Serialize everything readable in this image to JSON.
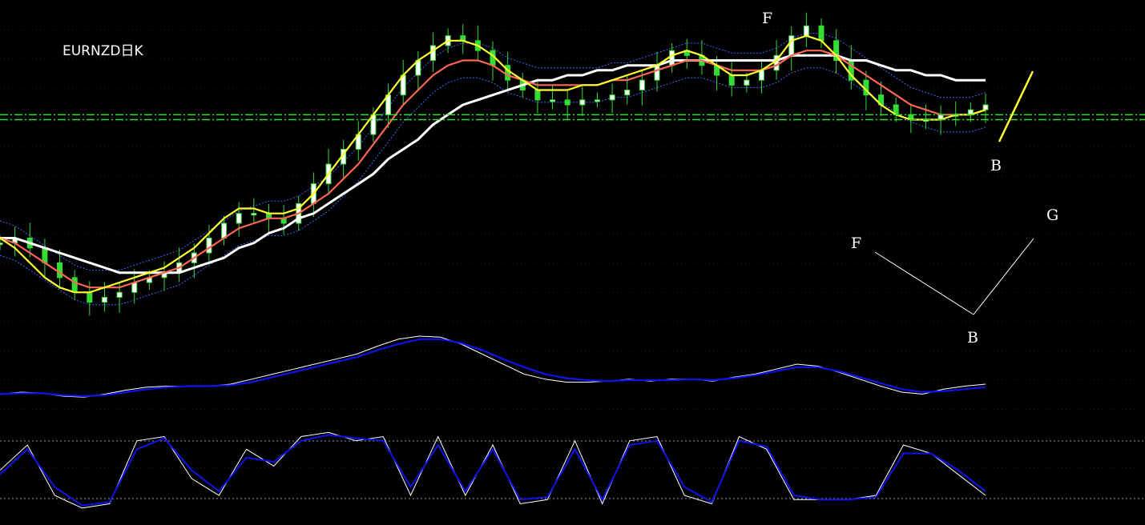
{
  "title": "EURNZD日K",
  "colors": {
    "background": "#000000",
    "candle": "#33dd33",
    "ma_fast": "#ffff33",
    "ma_mid": "#ff6655",
    "ma_slow": "#ffffff",
    "band": "#4466ff",
    "support": "#33dd33",
    "ind_line": "#ffffff",
    "ind_signal": "#1111ee",
    "grid": "#444444"
  },
  "annotations": {
    "f_top": "F",
    "b_price": "B",
    "diagram_f": "F",
    "diagram_b": "B",
    "diagram_g": "G"
  },
  "chart_data": [
    {
      "type": "candlestick",
      "title": "EURNZD日K",
      "series": [
        {
          "name": "close",
          "values": [
            0.54,
            0.55,
            0.53,
            0.5,
            0.47,
            0.44,
            0.42,
            0.43,
            0.44,
            0.46,
            0.47,
            0.48,
            0.5,
            0.52,
            0.55,
            0.58,
            0.6,
            0.6,
            0.59,
            0.58,
            0.62,
            0.66,
            0.7,
            0.73,
            0.76,
            0.8,
            0.84,
            0.88,
            0.91,
            0.94,
            0.96,
            0.95,
            0.93,
            0.9,
            0.87,
            0.85,
            0.83,
            0.83,
            0.82,
            0.83,
            0.83,
            0.84,
            0.85,
            0.87,
            0.9,
            0.93,
            0.92,
            0.9,
            0.88,
            0.86,
            0.87,
            0.89,
            0.92,
            0.96,
            0.98,
            0.95,
            0.91,
            0.87,
            0.84,
            0.82,
            0.8,
            0.79,
            0.79,
            0.8,
            0.8,
            0.81,
            0.82
          ]
        },
        {
          "name": "ma_fast",
          "values": [
            0.55,
            0.53,
            0.5,
            0.47,
            0.45,
            0.44,
            0.44,
            0.45,
            0.46,
            0.47,
            0.48,
            0.49,
            0.51,
            0.53,
            0.56,
            0.59,
            0.61,
            0.61,
            0.6,
            0.6,
            0.61,
            0.64,
            0.68,
            0.72,
            0.76,
            0.8,
            0.84,
            0.88,
            0.91,
            0.93,
            0.95,
            0.95,
            0.94,
            0.92,
            0.89,
            0.87,
            0.85,
            0.85,
            0.85,
            0.86,
            0.86,
            0.87,
            0.88,
            0.89,
            0.9,
            0.92,
            0.93,
            0.92,
            0.9,
            0.88,
            0.88,
            0.89,
            0.91,
            0.95,
            0.96,
            0.95,
            0.92,
            0.88,
            0.85,
            0.82,
            0.8,
            0.79,
            0.79,
            0.79,
            0.8,
            0.8,
            0.81
          ]
        },
        {
          "name": "ma_mid",
          "values": [
            0.55,
            0.54,
            0.52,
            0.5,
            0.48,
            0.46,
            0.45,
            0.45,
            0.45,
            0.46,
            0.47,
            0.48,
            0.49,
            0.51,
            0.53,
            0.55,
            0.57,
            0.58,
            0.59,
            0.59,
            0.6,
            0.62,
            0.64,
            0.67,
            0.7,
            0.74,
            0.78,
            0.82,
            0.85,
            0.88,
            0.9,
            0.91,
            0.91,
            0.9,
            0.88,
            0.87,
            0.86,
            0.86,
            0.86,
            0.86,
            0.86,
            0.87,
            0.87,
            0.88,
            0.89,
            0.9,
            0.91,
            0.91,
            0.9,
            0.89,
            0.89,
            0.89,
            0.9,
            0.92,
            0.93,
            0.93,
            0.92,
            0.9,
            0.88,
            0.86,
            0.84,
            0.82,
            0.81,
            0.8,
            0.8,
            0.8,
            0.81
          ]
        },
        {
          "name": "ma_slow",
          "values": [
            0.55,
            0.55,
            0.54,
            0.53,
            0.52,
            0.51,
            0.5,
            0.49,
            0.48,
            0.48,
            0.48,
            0.48,
            0.48,
            0.49,
            0.5,
            0.51,
            0.53,
            0.54,
            0.56,
            0.57,
            0.59,
            0.6,
            0.62,
            0.64,
            0.66,
            0.68,
            0.71,
            0.73,
            0.75,
            0.78,
            0.8,
            0.82,
            0.83,
            0.84,
            0.85,
            0.86,
            0.87,
            0.87,
            0.88,
            0.88,
            0.89,
            0.89,
            0.9,
            0.9,
            0.9,
            0.91,
            0.91,
            0.91,
            0.91,
            0.91,
            0.91,
            0.91,
            0.91,
            0.92,
            0.92,
            0.92,
            0.92,
            0.91,
            0.91,
            0.9,
            0.89,
            0.89,
            0.88,
            0.88,
            0.87,
            0.87,
            0.87
          ]
        }
      ],
      "support_levels": [
        0.8,
        0.79
      ]
    },
    {
      "type": "line",
      "series": [
        {
          "name": "indicator",
          "values": [
            0.3,
            0.32,
            0.31,
            0.28,
            0.27,
            0.3,
            0.34,
            0.37,
            0.38,
            0.38,
            0.38,
            0.4,
            0.45,
            0.5,
            0.55,
            0.6,
            0.65,
            0.7,
            0.78,
            0.85,
            0.88,
            0.87,
            0.8,
            0.7,
            0.6,
            0.5,
            0.45,
            0.42,
            0.42,
            0.43,
            0.45,
            0.43,
            0.45,
            0.45,
            0.43,
            0.47,
            0.5,
            0.55,
            0.6,
            0.58,
            0.52,
            0.45,
            0.38,
            0.32,
            0.3,
            0.35,
            0.38,
            0.4
          ]
        },
        {
          "name": "signal",
          "values": [
            0.3,
            0.31,
            0.31,
            0.29,
            0.28,
            0.29,
            0.32,
            0.35,
            0.37,
            0.38,
            0.38,
            0.39,
            0.42,
            0.47,
            0.52,
            0.57,
            0.62,
            0.67,
            0.74,
            0.8,
            0.85,
            0.85,
            0.81,
            0.74,
            0.65,
            0.57,
            0.5,
            0.46,
            0.44,
            0.43,
            0.44,
            0.44,
            0.44,
            0.45,
            0.44,
            0.46,
            0.49,
            0.53,
            0.57,
            0.57,
            0.53,
            0.47,
            0.41,
            0.35,
            0.32,
            0.33,
            0.35,
            0.37
          ]
        }
      ]
    },
    {
      "type": "line",
      "series": [
        {
          "name": "stoch_k",
          "values": [
            50,
            80,
            20,
            5,
            10,
            85,
            90,
            40,
            20,
            75,
            55,
            90,
            95,
            85,
            90,
            20,
            90,
            20,
            80,
            10,
            15,
            85,
            10,
            85,
            90,
            20,
            10,
            90,
            75,
            15,
            15,
            15,
            20,
            80,
            70,
            45,
            20
          ]
        },
        {
          "name": "stoch_d",
          "values": [
            45,
            75,
            30,
            8,
            12,
            75,
            88,
            50,
            25,
            65,
            60,
            85,
            92,
            88,
            85,
            30,
            80,
            25,
            75,
            15,
            18,
            75,
            15,
            80,
            85,
            30,
            12,
            85,
            78,
            20,
            15,
            15,
            18,
            70,
            70,
            50,
            25
          ]
        }
      ]
    }
  ]
}
